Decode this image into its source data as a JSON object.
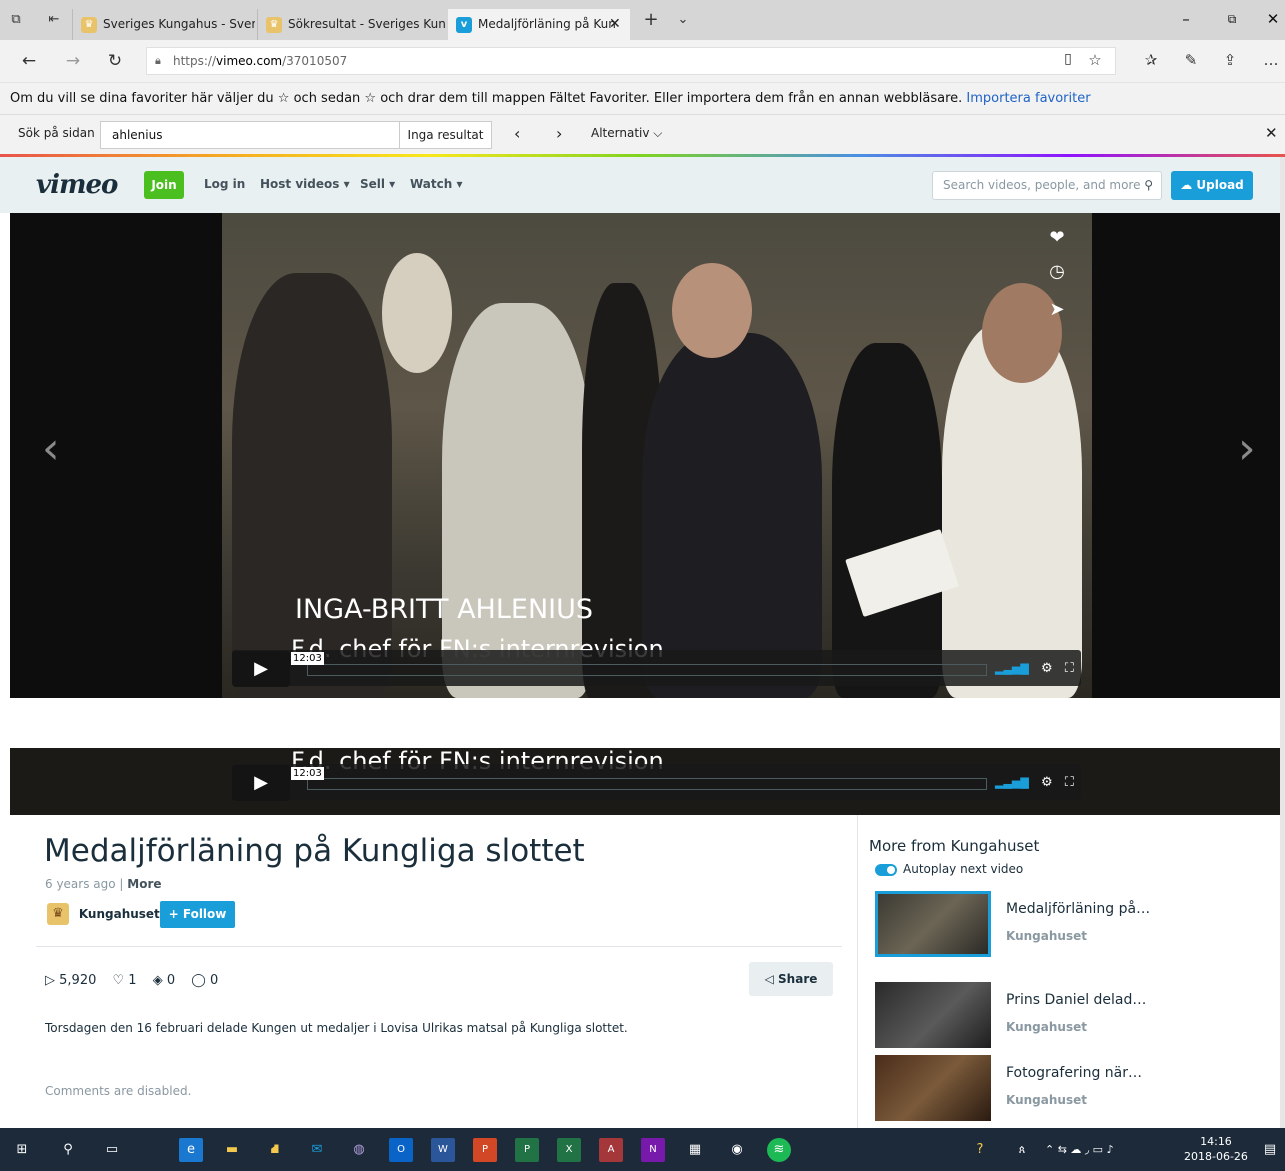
{
  "browser": {
    "tabs": [
      {
        "title": "Sveriges Kungahus - Sverige"
      },
      {
        "title": "Sökresultat - Sveriges Kung"
      },
      {
        "title": "Medaljförläning på Kun"
      }
    ],
    "url_prefix": "https://",
    "url_domain": "vimeo.com",
    "url_path": "/37010507",
    "favorites_note": "Om du vill se dina favoriter här väljer du ☆ och sedan ☆ och drar dem till mappen Fältet Favoriter. Eller importera dem från en annan webbläsare.",
    "favorites_link": "Importera favoriter",
    "find": {
      "label": "Sök på sidan",
      "value": "ahlenius",
      "result": "Inga resultat",
      "options": "Alternativ"
    }
  },
  "vimeo": {
    "logo": "vimeo",
    "join": "Join",
    "nav": [
      "Log in",
      "Host videos ▾",
      "Sell ▾",
      "Watch ▾"
    ],
    "search_placeholder": "Search videos, people, and more",
    "upload": "Upload"
  },
  "video": {
    "caption_name": "INGA-BRITT AHLENIUS",
    "caption_role": "F.d. chef för FN:s internrevision",
    "duration": "12:03",
    "title": "Medaljförläning på Kungliga slottet",
    "age": "6 years ago",
    "more": "More",
    "owner": "Kungahuset",
    "follow": "+ Follow",
    "plays": "5,920",
    "likes": "1",
    "collections": "0",
    "comments_count": "0",
    "share": "Share",
    "description": "Torsdagen den 16 februari delade Kungen ut medaljer i Lovisa Ulrikas matsal på Kungliga slottet.",
    "comments_status": "Comments are disabled."
  },
  "sidebar": {
    "title": "More from Kungahuset",
    "autoplay": "Autoplay next video",
    "items": [
      {
        "title": "Medaljförläning på…",
        "owner": "Kungahuset"
      },
      {
        "title": "Prins Daniel delad…",
        "owner": "Kungahuset"
      },
      {
        "title": "Fotografering när…",
        "owner": "Kungahuset"
      }
    ]
  },
  "taskbar": {
    "time": "14:16",
    "date": "2018-06-26"
  },
  "colors": {
    "vimeo_blue": "#1a9ed9",
    "join_green": "#4bbf1f",
    "taskbar": "#1c2a3a"
  }
}
